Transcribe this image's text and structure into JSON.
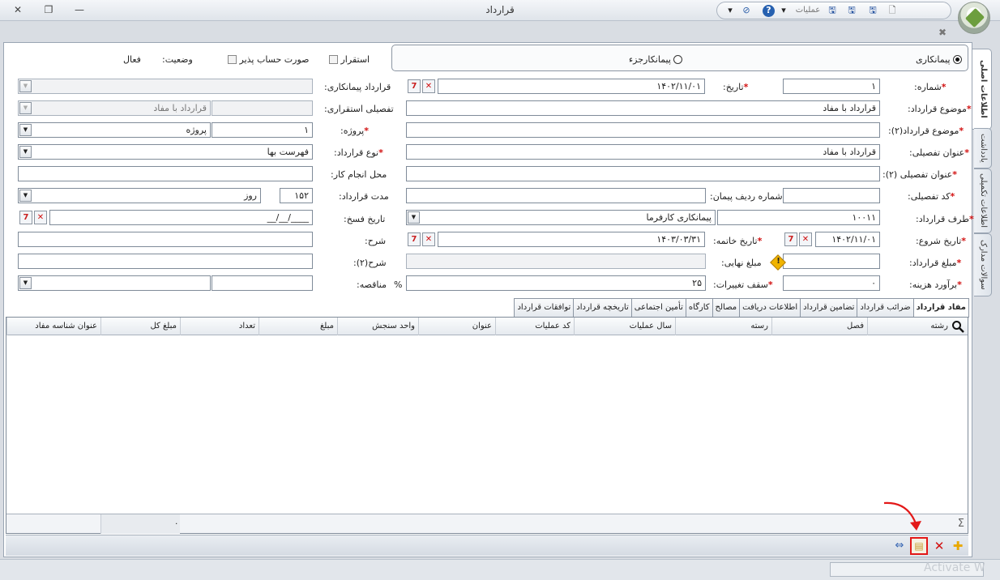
{
  "window": {
    "title": "قرارداد",
    "qat_label": "عملیات"
  },
  "contract_type": {
    "options": [
      "پیمانکاری",
      "پیمانکارجزء"
    ],
    "selected": "پیمانکاری"
  },
  "flags": {
    "esteghrar_label": "استقرار",
    "invoice_label": "صورت حساب پذیر",
    "status_label": "وضعیت:",
    "status_value": "فعال"
  },
  "form": {
    "number_label": "شماره:",
    "number_value": "۱",
    "date_label": "تاریخ:",
    "date_value": "۱۴۰۲/۱۱/۰۱",
    "contractor_contract_label": "قرارداد پیمانکاری:",
    "subject_label": "موضوع قرارداد:",
    "subject_value": "قرارداد با مفاد",
    "detail_esteghrari_label": "تفصیلی استقراری:",
    "detail_esteghrari_value": "قرارداد با مفاد",
    "subject2_label": "موضوع قرارداد(۲):",
    "project_label": "پروژه:",
    "project_code": "۱",
    "project_name": "پروژه",
    "detail_title_label": "عنوان تفصیلی:",
    "detail_title_value": "قرارداد با مفاد",
    "contract_kind_label": "نوع قرارداد:",
    "contract_kind_value": "فهرست بها",
    "detail_title2_label": "عنوان تفصیلی (۲):",
    "work_place_label": "محل انجام کار:",
    "detail_code_label": "کد تفصیلی:",
    "peyman_row_label": "شماره ردیف پیمان:",
    "duration_label": "مدت قرارداد:",
    "duration_value": "۱۵۲",
    "duration_unit": "روز",
    "party_label": "طرف قرارداد:",
    "party_code": "۱۰۰۱۱",
    "party_name": "پیمانکاری کارفرما",
    "cancel_date_label": "تاریخ فسخ:",
    "cancel_date_value": "__/__/____",
    "start_date_label": "تاریخ شروع:",
    "start_date_value": "۱۴۰۲/۱۱/۰۱",
    "end_date_label": "تاریخ خاتمه:",
    "end_date_value": "۱۴۰۳/۰۳/۳۱",
    "desc_label": "شرح:",
    "amount_label": "مبلغ قرارداد:",
    "final_amount_label": "مبلغ نهایی:",
    "desc2_label": "شرح(۲):",
    "estimate_label": "برآورد هزینه:",
    "estimate_value": "۰",
    "change_cap_label": "سقف تغییرات:",
    "change_cap_value": "۲۵",
    "percent_sign": "%",
    "tender_label": "مناقصه:"
  },
  "side_tabs": [
    "اطلاعات اصلی",
    "یادداشت",
    "اطلاعات تکمیلی",
    "سوالات مدارک"
  ],
  "bottom_tabs": [
    "مفاد قرارداد",
    "ضرائب قرارداد",
    "تضامین قرارداد",
    "اطلاعات دریافت",
    "مصالح",
    "کارگاه",
    "تأمین اجتماعی",
    "تاریخچه قرارداد",
    "توافقات قرارداد"
  ],
  "grid": {
    "columns": [
      "رشته",
      "فصل",
      "رسته",
      "سال عملیات",
      "کد عملیات",
      "عنوان",
      "واحد سنجش",
      "مبلغ",
      "تعداد",
      "مبلغ کل",
      "عنوان شناسه مفاد"
    ],
    "footer_total": "۰"
  },
  "statusbar": {
    "watermark": "Activate W"
  }
}
